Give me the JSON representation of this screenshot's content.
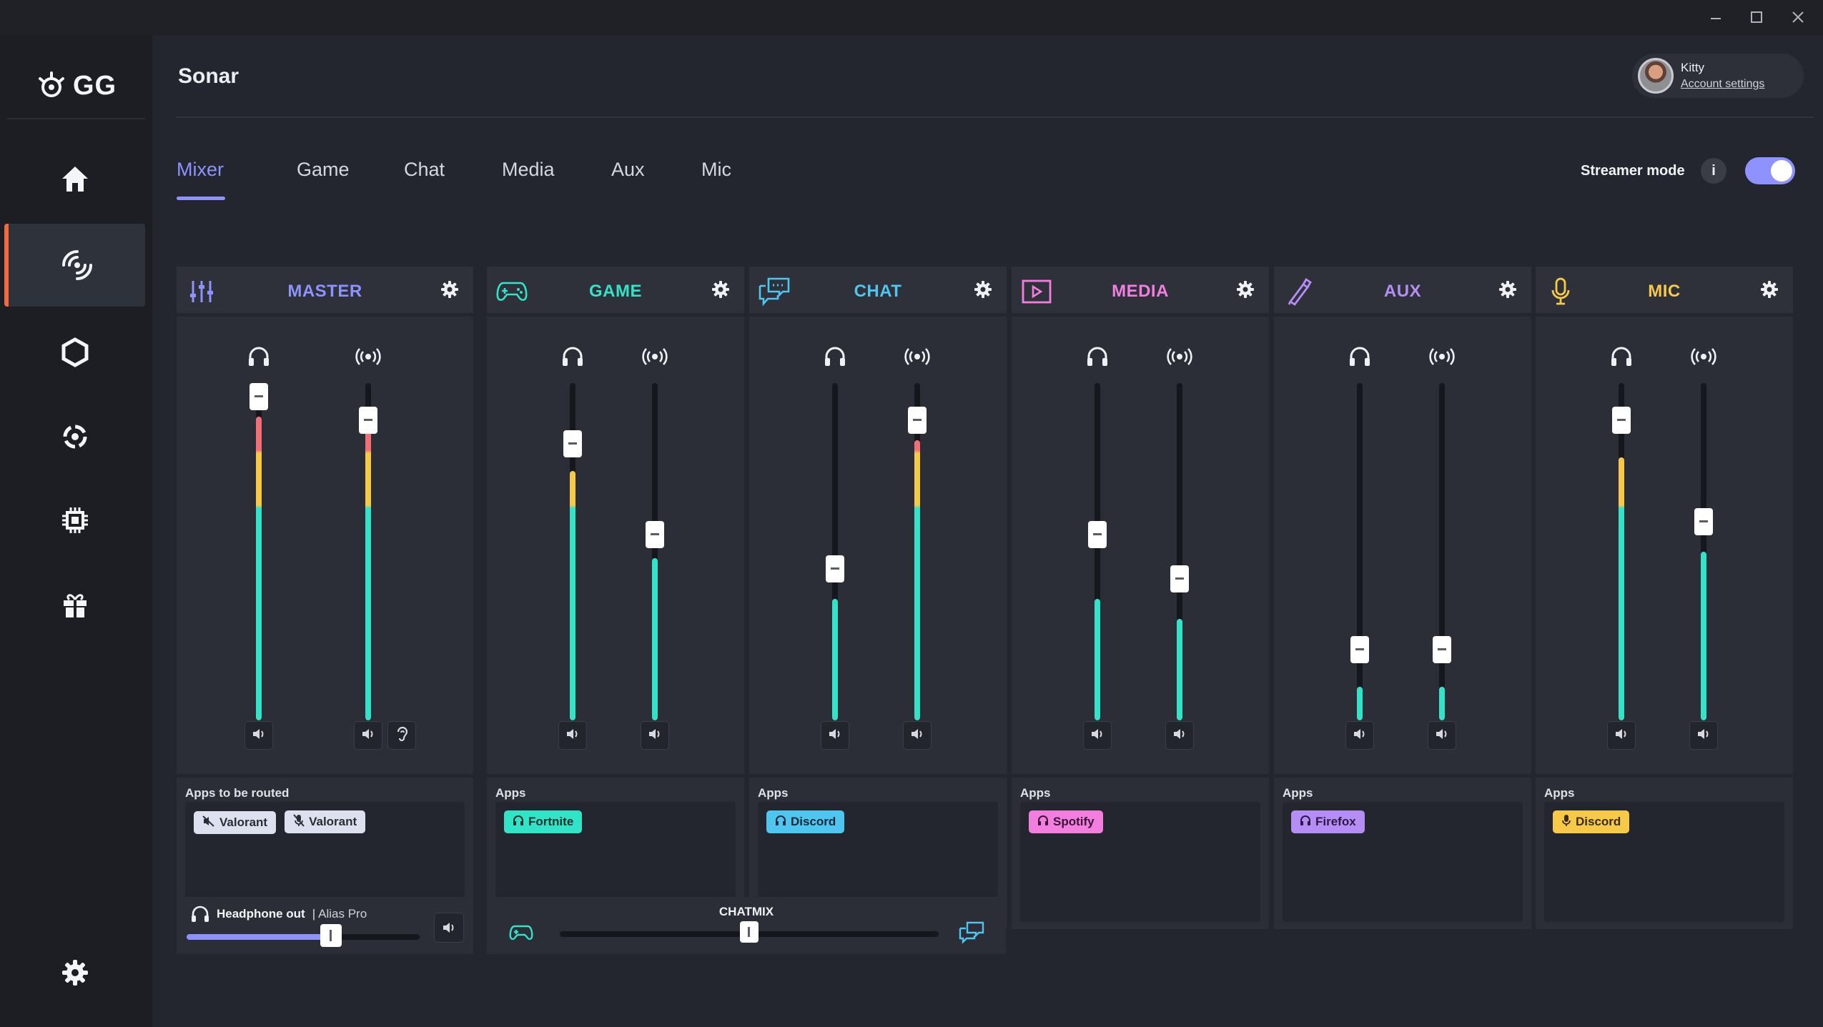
{
  "app": {
    "brand": "GG",
    "title": "Sonar"
  },
  "account": {
    "name": "Kitty",
    "link": "Account settings"
  },
  "tabs": [
    {
      "label": "Mixer",
      "active": true
    },
    {
      "label": "Game"
    },
    {
      "label": "Chat"
    },
    {
      "label": "Media"
    },
    {
      "label": "Aux"
    },
    {
      "label": "Mic"
    }
  ],
  "streamer_mode": {
    "label": "Streamer mode",
    "info": "i",
    "enabled": true
  },
  "sidebar": {
    "items": [
      "home-icon",
      "sonar-icon",
      "engine-icon",
      "moments-icon",
      "chip-icon",
      "gift-icon"
    ],
    "settings": "gear-icon"
  },
  "channels": [
    {
      "key": "master",
      "name": "MASTER",
      "color": "#8e92ff",
      "apps_label": "Apps to be routed",
      "apps": [
        {
          "label": "Valorant",
          "icon": "muted-speaker-icon"
        },
        {
          "label": "Valorant",
          "icon": "muted-mic-icon"
        }
      ],
      "chip_bg": "#dde0ee",
      "chip_fg": "#2a2d35",
      "sliders": [
        {
          "kind": "headphone",
          "level": 0.96,
          "meter": 0.9
        },
        {
          "kind": "stream",
          "level": 0.89,
          "meter": 0.86
        }
      ]
    },
    {
      "key": "game",
      "name": "GAME",
      "color": "#33e3c8",
      "apps_label": "Apps",
      "apps": [
        {
          "label": "Fortnite",
          "icon": "headphone-icon"
        }
      ],
      "chip_bg": "#33e3c8",
      "chip_fg": "#14302c",
      "sliders": [
        {
          "kind": "headphone",
          "level": 0.82,
          "meter": 0.74
        },
        {
          "kind": "stream",
          "level": 0.55,
          "meter": 0.48
        }
      ]
    },
    {
      "key": "chat",
      "name": "CHAT",
      "color": "#4fc6f0",
      "apps_label": "Apps",
      "apps": [
        {
          "label": "Discord",
          "icon": "headphone-icon"
        }
      ],
      "chip_bg": "#4fc6f0",
      "chip_fg": "#10283a",
      "sliders": [
        {
          "kind": "headphone",
          "level": 0.45,
          "meter": 0.36
        },
        {
          "kind": "stream",
          "level": 0.89,
          "meter": 0.83
        }
      ]
    },
    {
      "key": "media",
      "name": "MEDIA",
      "color": "#f27ee0",
      "apps_label": "Apps",
      "apps": [
        {
          "label": "Spotify",
          "icon": "headphone-icon"
        }
      ],
      "chip_bg": "#f27ee0",
      "chip_fg": "#3a1434",
      "sliders": [
        {
          "kind": "headphone",
          "level": 0.55,
          "meter": 0.36
        },
        {
          "kind": "stream",
          "level": 0.42,
          "meter": 0.3
        }
      ]
    },
    {
      "key": "aux",
      "name": "AUX",
      "color": "#b68df5",
      "apps_label": "Apps",
      "apps": [
        {
          "label": "Firefox",
          "icon": "headphone-icon"
        }
      ],
      "chip_bg": "#b68df5",
      "chip_fg": "#2a1a44",
      "sliders": [
        {
          "kind": "headphone",
          "level": 0.21,
          "meter": 0.1
        },
        {
          "kind": "stream",
          "level": 0.21,
          "meter": 0.1
        }
      ]
    },
    {
      "key": "mic",
      "name": "MIC",
      "color": "#f7c948",
      "apps_label": "Apps",
      "apps": [
        {
          "label": "Discord",
          "icon": "mic-icon"
        }
      ],
      "chip_bg": "#f7c948",
      "chip_fg": "#3a2c0a",
      "sliders": [
        {
          "kind": "headphone",
          "level": 0.89,
          "meter": 0.78
        },
        {
          "kind": "stream",
          "level": 0.59,
          "meter": 0.5
        }
      ]
    }
  ],
  "headphone_out": {
    "label": "Headphone out",
    "device": "Alias Pro",
    "separator": "|",
    "level": 0.62
  },
  "chatmix": {
    "label": "CHATMIX",
    "balance": 0.5
  }
}
